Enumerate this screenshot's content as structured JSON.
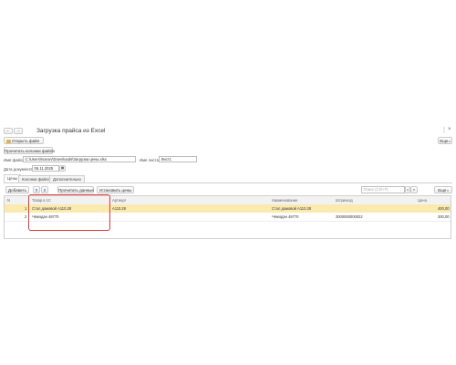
{
  "window": {
    "title": "Загрузка прайса из Excel",
    "more_label": "Еще"
  },
  "toolbar": {
    "open_file_label": "Открыть файл",
    "read_sheets_label": "Прочитать колонки файла"
  },
  "form": {
    "file_name_label": "Имя файла:",
    "file_name_value": "C:\\Users\\Ivanov\\Downloads\\Загрузка цены.xlsx",
    "sheet_label": "Имя листа:",
    "sheet_value": "Лист1",
    "doc_date_label": "Дата документа:",
    "doc_date_value": "06.11.2025"
  },
  "tabs": [
    {
      "label": "Цены"
    },
    {
      "label": "Колонки файла"
    },
    {
      "label": "Дополнительно"
    }
  ],
  "table_toolbar": {
    "add_label": "Добавить",
    "read_data_label": "Прочитать данные",
    "set_prices_label": "Установить цены",
    "search_placeholder": "Поиск (Ctrl+F)",
    "more_label": "Еще"
  },
  "table": {
    "columns": [
      "N",
      "Товар в 1С",
      "Артикул",
      "Наименование",
      "Штрихкод",
      "Цена"
    ],
    "rows": [
      {
        "n": "1",
        "product": "Стол домовой А110.28",
        "article": "А110.28",
        "name": "Стол домовой А110.28",
        "barcode": "",
        "price": "400,00"
      },
      {
        "n": "2",
        "product": "Чемодан 48770",
        "article": "",
        "name": "Чемодан 48770",
        "barcode": "2000000000022",
        "price": "200,00"
      }
    ]
  },
  "colors": {
    "selected_row": "#fbeab0",
    "highlight_border": "#e03a3a",
    "header_bg": "#f2f2f2"
  }
}
